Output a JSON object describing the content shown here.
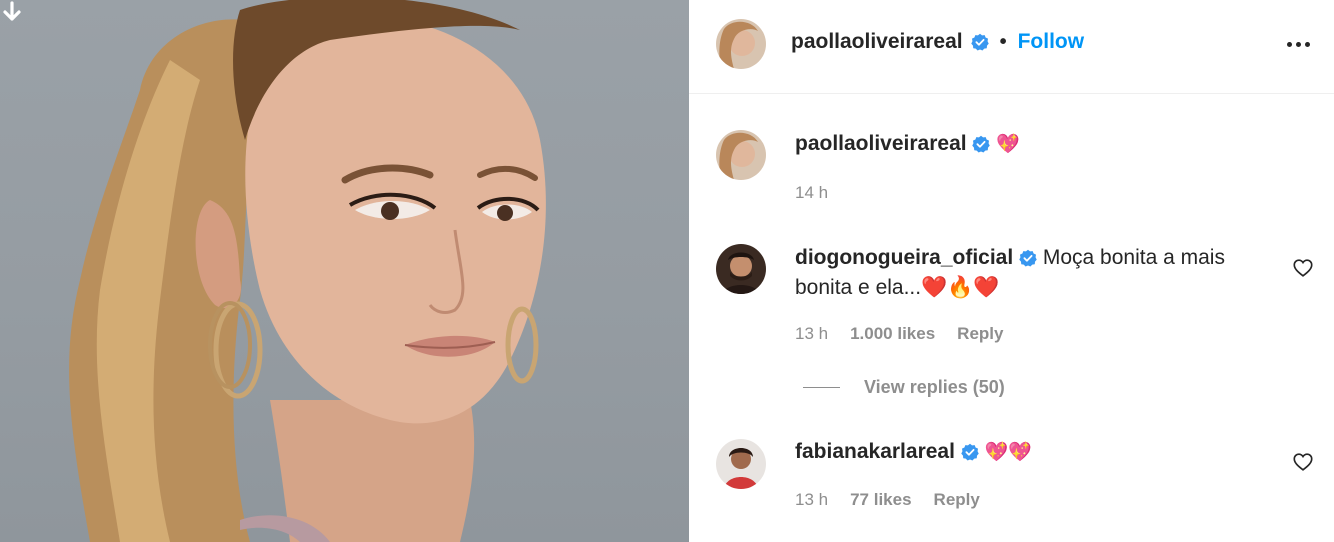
{
  "post": {
    "author": "paollaoliveirareal",
    "follow_label": "Follow",
    "separator": "•",
    "more_options": "more-horizontal-icon"
  },
  "caption": {
    "username": "paollaoliveirareal",
    "text": "💖",
    "time": "14 h"
  },
  "comments": [
    {
      "username": "diogonogueira_oficial",
      "text": "Moça bonita a mais bonita e ela...❤️🔥❤️",
      "time": "13 h",
      "likes": "1.000 likes",
      "reply_label": "Reply",
      "view_replies": "View replies (50)"
    },
    {
      "username": "fabianakarlareal",
      "text": "💖💖",
      "time": "13 h",
      "likes": "77 likes",
      "reply_label": "Reply"
    }
  ],
  "colors": {
    "link_blue": "#0095f6",
    "verified_blue": "#3897f0",
    "secondary_text": "#8e8e8e",
    "primary_text": "#262626"
  }
}
